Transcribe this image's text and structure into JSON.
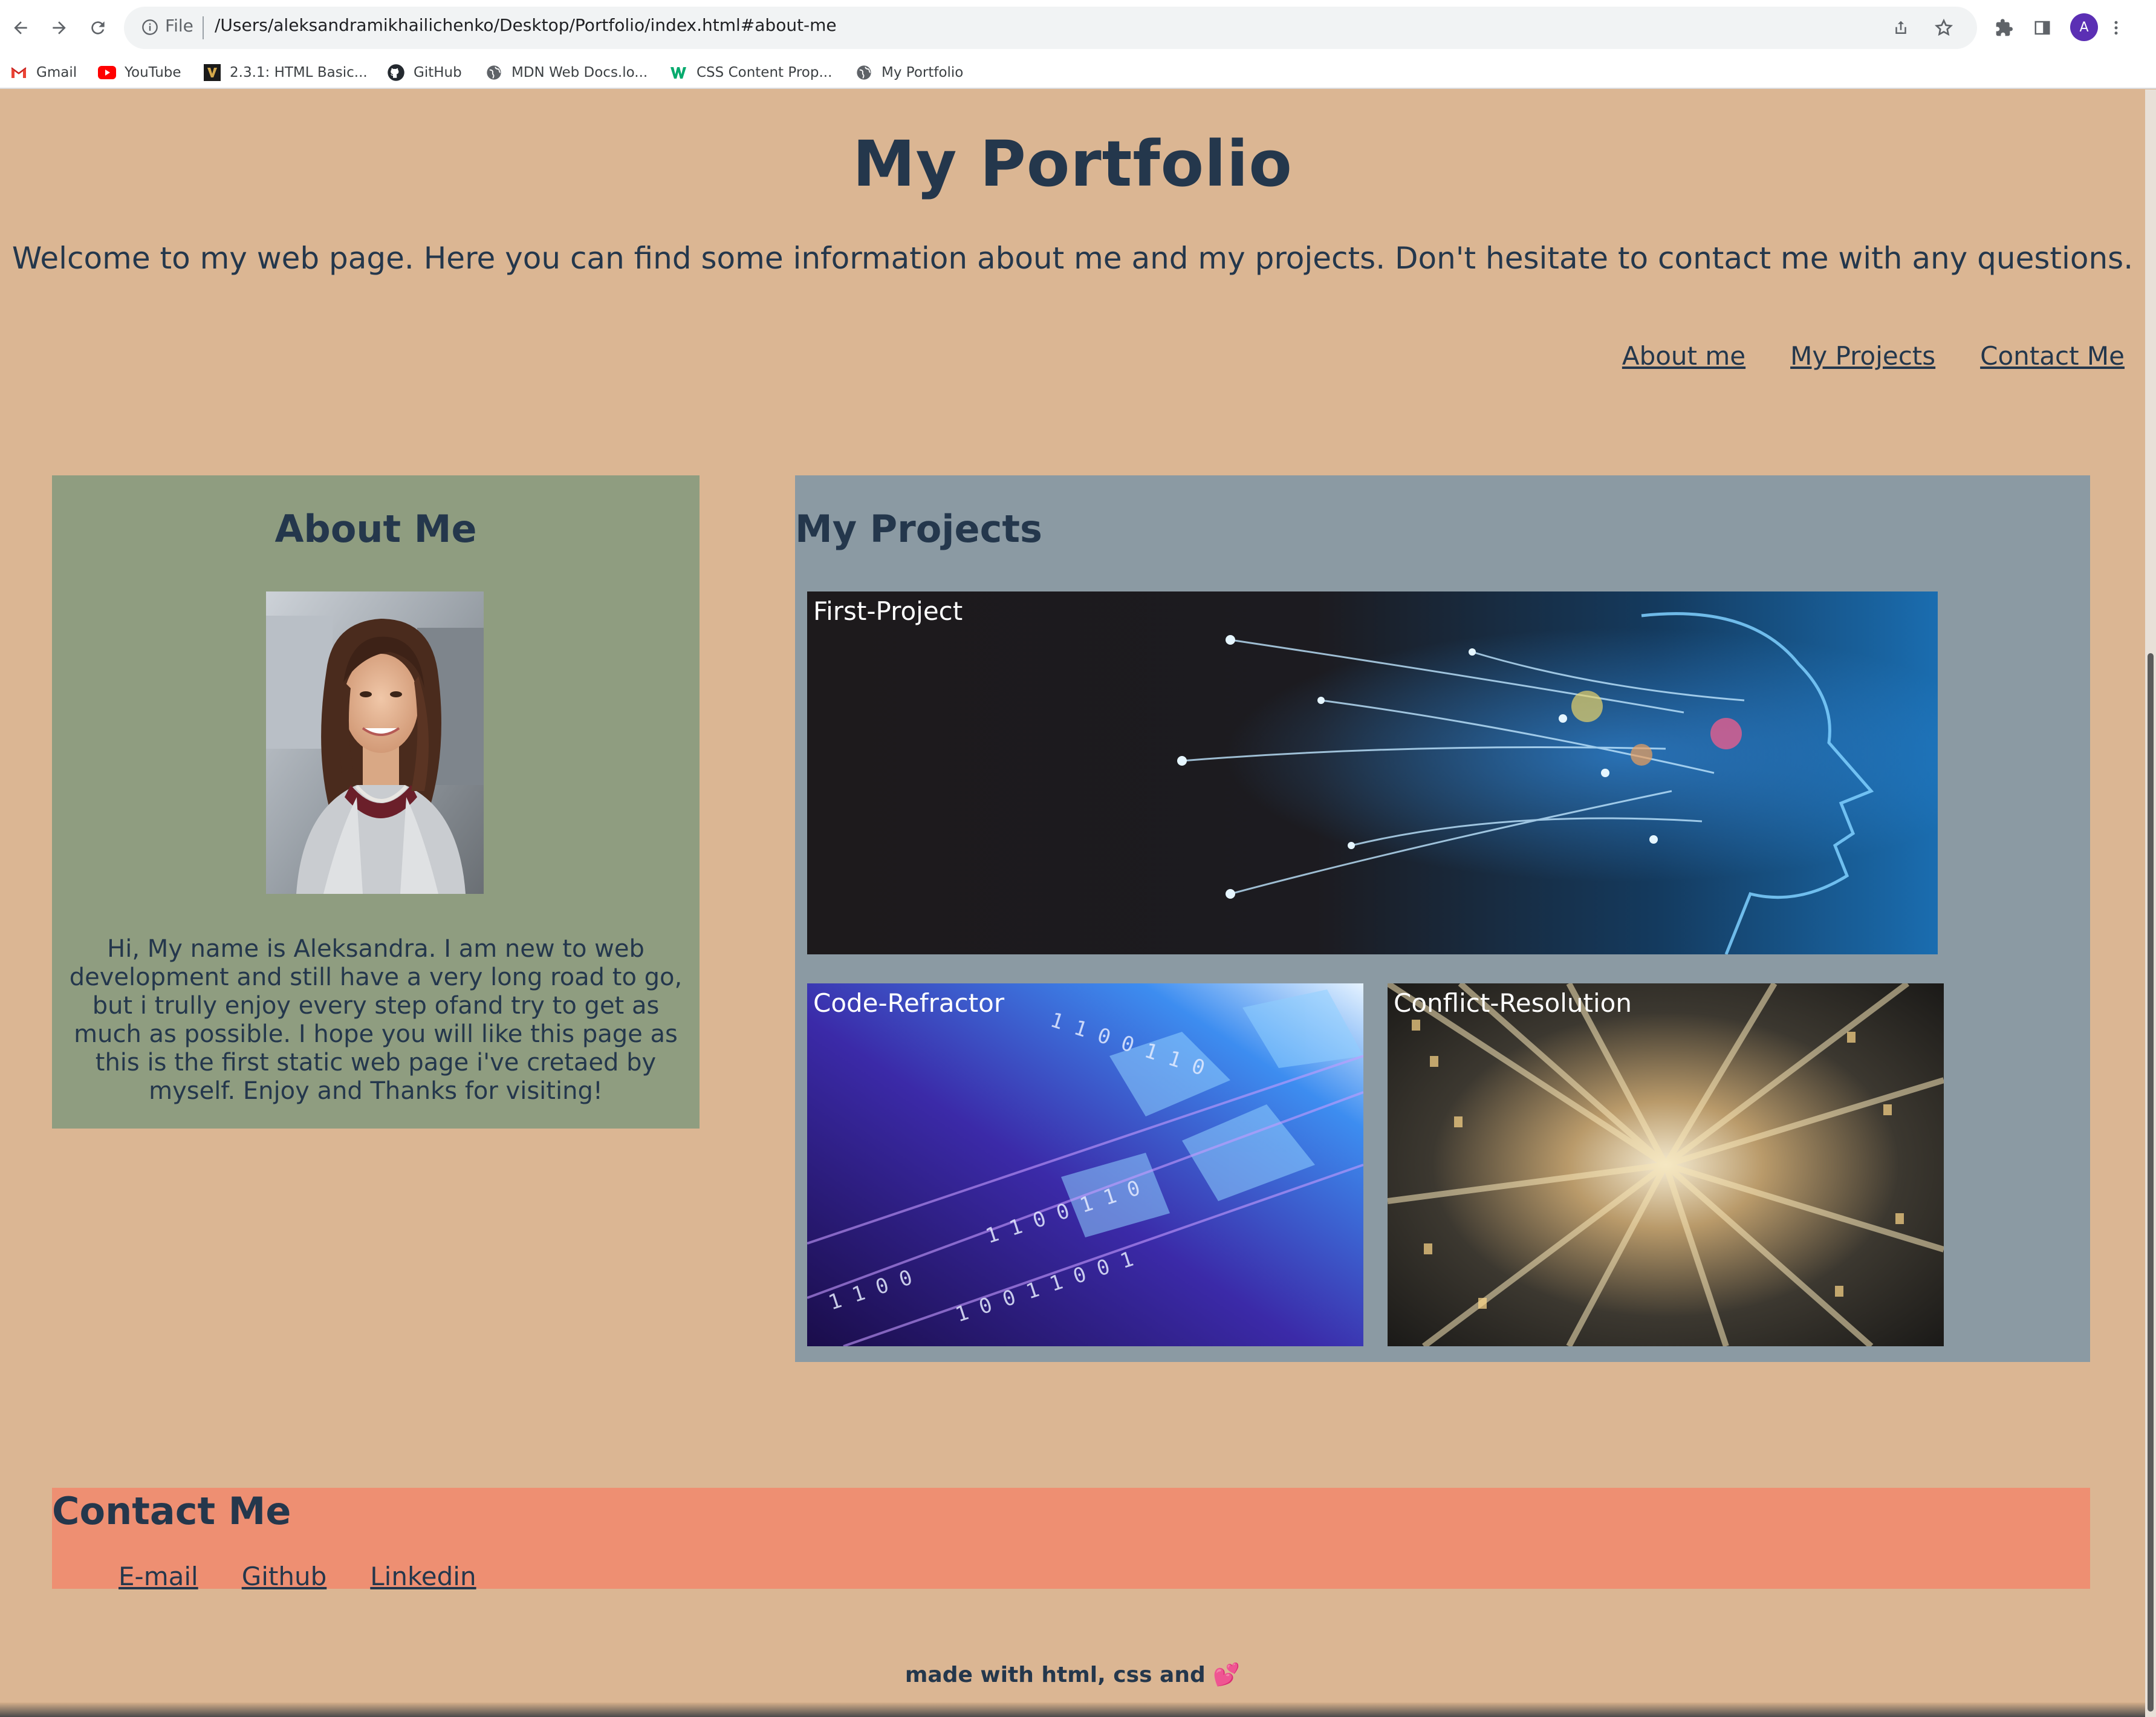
{
  "browser": {
    "omnibox": {
      "scheme_label": "File",
      "url": "/Users/aleksandramikhailichenko/Desktop/Portfolio/index.html#about-me"
    },
    "profile_initial": "A",
    "bookmarks": [
      {
        "label": "Gmail",
        "icon": "gmail-icon"
      },
      {
        "label": "YouTube",
        "icon": "youtube-icon"
      },
      {
        "label": "2.3.1: HTML Basic...",
        "icon": "course-icon"
      },
      {
        "label": "GitHub",
        "icon": "github-icon"
      },
      {
        "label": "MDN Web Docs.lo...",
        "icon": "globe-icon"
      },
      {
        "label": "CSS Content Prop...",
        "icon": "w3-icon"
      },
      {
        "label": "My Portfolio",
        "icon": "globe-icon"
      }
    ]
  },
  "header": {
    "title": "My Portfolio",
    "welcome": "Welcome to my web page. Here you can find some information about me and my projects. Don't hesitate to contact me with any questions."
  },
  "nav": {
    "about": "About me",
    "projects": "My Projects",
    "contact": "Contact Me"
  },
  "about": {
    "heading": "About Me",
    "text": "Hi, My name is Aleksandra. I am new to web development and still have a very long road to go, but i trully enjoy every step ofand try to get as much as possible. I hope you will like this page as this is the first static web page i've cretaed by myself. Enjoy and Thanks for visiting!"
  },
  "projects": {
    "heading": "My Projects",
    "items": [
      {
        "label": "First-Project"
      },
      {
        "label": "Code-Refractor"
      },
      {
        "label": "Conflict-Resolution"
      }
    ]
  },
  "contact": {
    "heading": "Contact Me",
    "links": [
      "E-mail",
      "Github",
      "Linkedin"
    ]
  },
  "footer": {
    "text": "made with html, css and",
    "emoji": "💕"
  },
  "colors": {
    "page_bg": "#dbb693",
    "about_bg": "#8f9d80",
    "projects_bg": "#8b9aa3",
    "contact_bg": "#ee8f72",
    "text": "#24374c"
  }
}
